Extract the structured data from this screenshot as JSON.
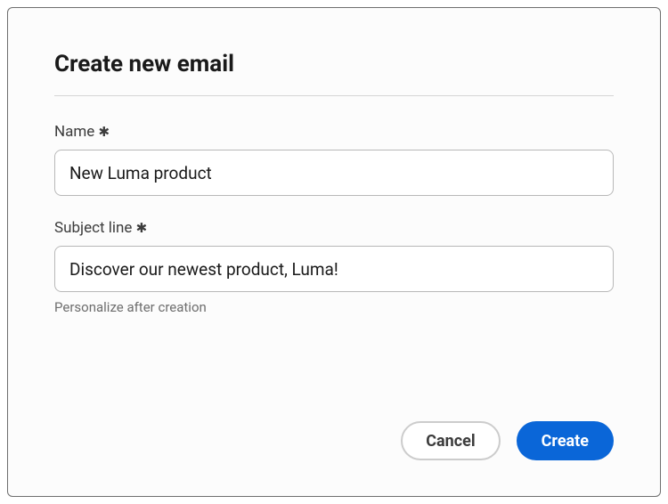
{
  "dialog": {
    "title": "Create new email",
    "fields": {
      "name": {
        "label": "Name",
        "required_marker": "✱",
        "value": "New Luma product"
      },
      "subject": {
        "label": "Subject line",
        "required_marker": "✱",
        "value": "Discover our newest product, Luma!",
        "helper": "Personalize after creation"
      }
    },
    "buttons": {
      "cancel": "Cancel",
      "create": "Create"
    }
  }
}
